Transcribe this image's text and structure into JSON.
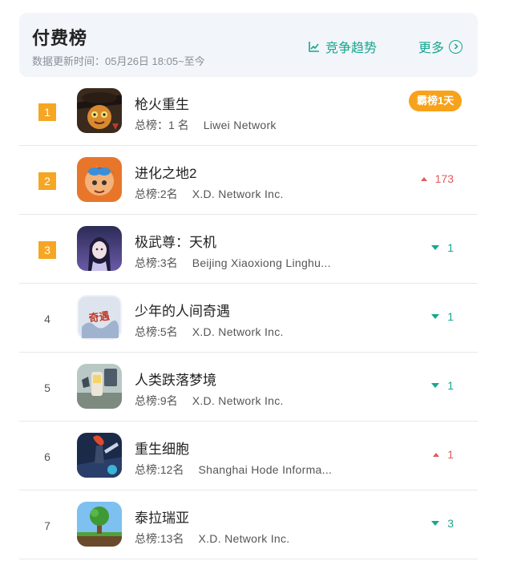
{
  "header": {
    "title": "付费榜",
    "subtitle": "数据更新时间：05月26日 18:05~至今",
    "trend_label": "竞争趋势",
    "more_label": "更多",
    "accent_color": "#18a690"
  },
  "apps": [
    {
      "rank": "1",
      "name": "枪火重生",
      "overall": "总榜：1 名",
      "developer": "Liwei Network",
      "badge": "霸榜1天",
      "change": "",
      "change_dir": "none",
      "icon": "gunfire-reborn-icon"
    },
    {
      "rank": "2",
      "name": "进化之地2",
      "overall": "总榜:2名",
      "developer": "X.D. Network Inc.",
      "badge": "",
      "change": "173",
      "change_dir": "up",
      "icon": "evoland2-icon"
    },
    {
      "rank": "3",
      "name": "极武尊：天机",
      "overall": "总榜:3名",
      "developer": "Beijing Xiaoxiong Linghu...",
      "badge": "",
      "change": "1",
      "change_dir": "down",
      "icon": "jiwuzun-icon"
    },
    {
      "rank": "4",
      "name": "少年的人间奇遇",
      "overall": "总榜:5名",
      "developer": "X.D. Network Inc.",
      "badge": "",
      "change": "1",
      "change_dir": "down",
      "icon": "shaonian-icon"
    },
    {
      "rank": "5",
      "name": "人类跌落梦境",
      "overall": "总榜:9名",
      "developer": "X.D. Network Inc.",
      "badge": "",
      "change": "1",
      "change_dir": "down",
      "icon": "human-fall-flat-icon"
    },
    {
      "rank": "6",
      "name": "重生细胞",
      "overall": "总榜:12名",
      "developer": "Shanghai Hode Informa...",
      "badge": "",
      "change": "1",
      "change_dir": "up",
      "icon": "dead-cells-icon"
    },
    {
      "rank": "7",
      "name": "泰拉瑞亚",
      "overall": "总榜:13名",
      "developer": "X.D. Network Inc.",
      "badge": "",
      "change": "3",
      "change_dir": "down",
      "icon": "terraria-icon"
    }
  ]
}
